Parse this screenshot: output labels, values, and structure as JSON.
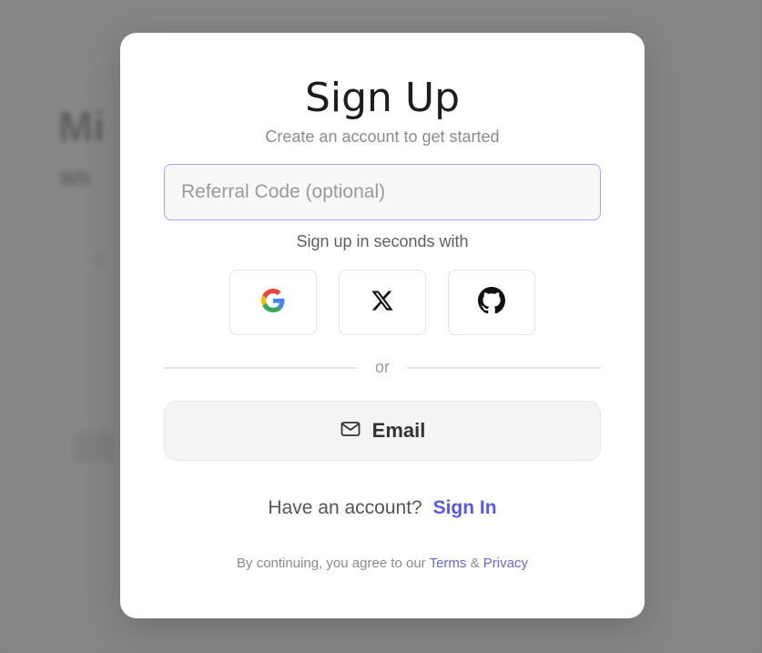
{
  "background": {
    "title": "Mi",
    "subtitle": "Wh",
    "small_text": "C"
  },
  "modal": {
    "title": "Sign Up",
    "subtitle": "Create an account to get started",
    "referral_placeholder": "Referral Code (optional)",
    "referral_value": "",
    "social_label": "Sign up in seconds with",
    "social_buttons": [
      {
        "provider": "google",
        "icon": "google-icon"
      },
      {
        "provider": "x",
        "icon": "x-icon"
      },
      {
        "provider": "github",
        "icon": "github-icon"
      }
    ],
    "divider_text": "or",
    "email_button": {
      "label": "Email",
      "icon": "mail-icon"
    },
    "account_prompt": "Have an account?",
    "sign_in_link": "Sign In",
    "legal": {
      "prefix": "By continuing, you agree to our",
      "terms": "Terms",
      "connector": "&",
      "privacy": "Privacy"
    }
  },
  "colors": {
    "accent": "#5b58e6",
    "input_border": "#a8a6f3",
    "overlay": "#6e6e6e"
  }
}
